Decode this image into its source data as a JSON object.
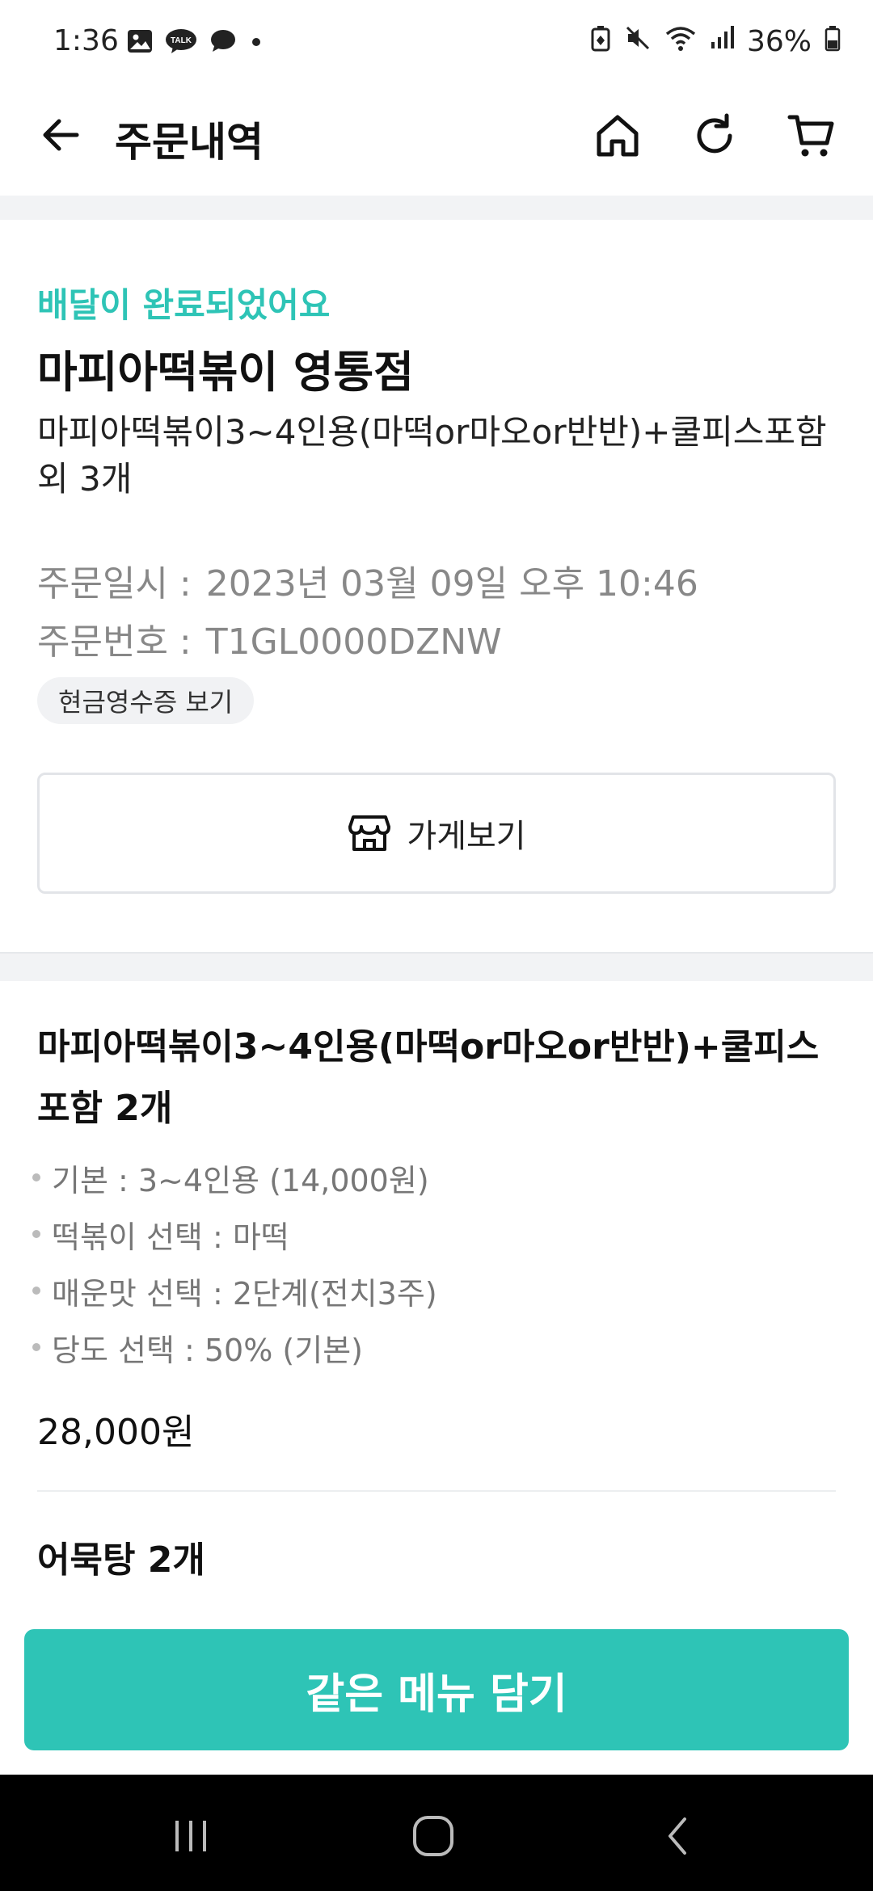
{
  "status_bar": {
    "time": "1:36",
    "battery": "36%",
    "icons": [
      "gallery-icon",
      "kakaotalk-icon",
      "chat-icon",
      "dot-icon",
      "battery-saver-icon",
      "mute-icon",
      "wifi-icon",
      "signal-icon",
      "battery-icon"
    ]
  },
  "header": {
    "title": "주문내역",
    "actions": [
      "home-icon",
      "refresh-icon",
      "cart-icon"
    ]
  },
  "order": {
    "status": "배달이 완료되었어요",
    "store_name": "마피아떡볶이 영통점",
    "summary": "마피아떡볶이3~4인용(마떡or마오or반반)+쿨피스포함 외 3개",
    "date_label": "주문일시 :",
    "date_value": "2023년 03월 09일 오후 10:46",
    "number_label": "주문번호 :",
    "number_value": "T1GL0000DZNW",
    "receipt_button": "현금영수증 보기",
    "store_button": "가게보기"
  },
  "items": [
    {
      "title": "마피아떡볶이3~4인용(마떡or마오or반반)+쿨피스포함 2개",
      "options": [
        "기본 : 3~4인용 (14,000원)",
        "떡볶이 선택 : 마떡",
        "매운맛 선택 : 2단계(전치3주)",
        "당도 선택 : 50% (기본)"
      ],
      "price": "28,000원"
    },
    {
      "title": "어묵탕 2개"
    }
  ],
  "cta": {
    "label": "같은 메뉴 담기"
  },
  "colors": {
    "accent": "#2ec4b6",
    "muted_text": "#888888",
    "separator": "#f2f3f5"
  }
}
